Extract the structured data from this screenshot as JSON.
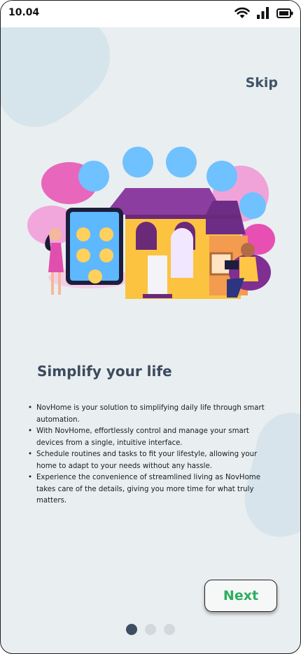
{
  "status_bar": {
    "time": "10.04",
    "icons": [
      "wifi-icon",
      "signal-icon",
      "battery-icon"
    ]
  },
  "onboarding": {
    "skip_label": "Skip",
    "illustration": "smart-home-illustration",
    "title": "Simplify your life",
    "bullets": [
      "NovHome is your solution to simplifying daily life through smart automation.",
      "With NovHome, effortlessly control and manage your smart devices from a single, intuitive interface.",
      "Schedule routines and tasks to fit your lifestyle, allowing your home to adapt to your needs without any hassle.",
      "Experience the convenience of streamlined living as NovHome takes care of the details, giving you more time for what truly matters."
    ],
    "next_label": "Next",
    "pagination": {
      "total": 3,
      "current": 1
    }
  },
  "colors": {
    "background": "#e9eef0",
    "title": "#3c4b5e",
    "next_text": "#2dae5f",
    "dot_active": "#3e4e62",
    "dot_inactive": "#d3d8dc"
  }
}
